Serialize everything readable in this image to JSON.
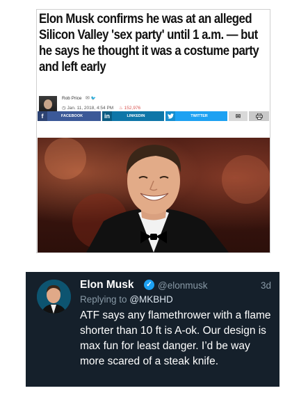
{
  "article": {
    "headline": "Elon Musk confirms he was at an alleged Silicon Valley 'sex party' until 1 a.m. — but he says he thought it was a costume party and left early",
    "author": "Rob Price",
    "author_icons": "✉ ♥",
    "date": "Jan. 11, 2018, 4:54 PM",
    "views": "152,976",
    "share": {
      "facebook": "FACEBOOK",
      "linkedin": "LINKEDIN",
      "twitter": "TWITTER"
    }
  },
  "tweet": {
    "name": "Elon Musk",
    "handle": "@elonmusk",
    "time": "3d",
    "replying_prefix": "Replying to",
    "replying_to": "@MKBHD",
    "text": "ATF says any flamethrower with a flame shorter than 10 ft is A-ok. Our design is max fun for least danger. I’d be way more scared of a steak knife."
  },
  "colors": {
    "facebook": "#3b5998",
    "linkedin": "#0e76a8",
    "twitter": "#1da1f2",
    "tweet_bg": "#15202b",
    "muted": "#8899a6"
  },
  "icons": [
    "author-avatar",
    "mail-icon",
    "twitter-bird-icon",
    "clock-icon",
    "fire-icon",
    "facebook-icon",
    "linkedin-icon",
    "mail-share-icon",
    "print-icon",
    "verified-badge-icon"
  ]
}
